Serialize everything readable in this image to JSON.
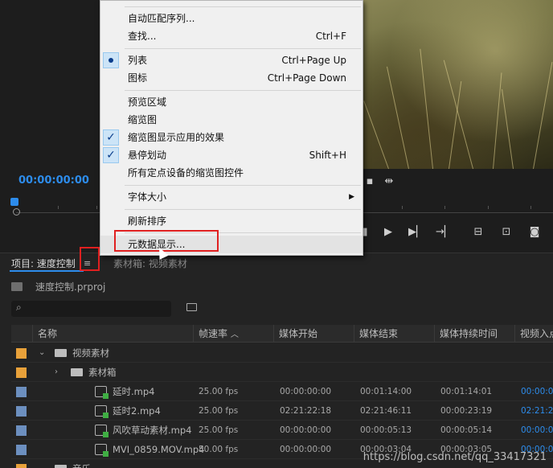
{
  "monitor": {
    "timecode": "00:00:00:00",
    "icons": [
      "marker-icon",
      "play-icon",
      "step-forward-icon",
      "go-to-out-icon",
      "insert-icon",
      "overwrite-icon",
      "camera-icon"
    ]
  },
  "context_menu": {
    "items": [
      {
        "label": "自动匹配序列...",
        "shortcut": ""
      },
      {
        "label": "查找...",
        "shortcut": "Ctrl+F"
      },
      {
        "label": "列表",
        "shortcut": "Ctrl+Page Up",
        "radio": true
      },
      {
        "label": "图标",
        "shortcut": "Ctrl+Page Down"
      },
      {
        "label": "预览区域",
        "shortcut": ""
      },
      {
        "label": "缩览图",
        "shortcut": ""
      },
      {
        "label": "缩览图显示应用的效果",
        "shortcut": "",
        "checked": true
      },
      {
        "label": "悬停划动",
        "shortcut": "Shift+H",
        "checked": true
      },
      {
        "label": "所有定点设备的缩览图控件",
        "shortcut": ""
      },
      {
        "label": "字体大小",
        "shortcut": "",
        "submenu": true
      },
      {
        "label": "刷新排序",
        "shortcut": ""
      },
      {
        "label": "元数据显示...",
        "shortcut": ""
      }
    ]
  },
  "project_panel": {
    "tab_project": "项目: 速度控制",
    "tab_bin": "素材箱: 视频素材",
    "project_file": "速度控制.prproj",
    "search_placeholder": "",
    "columns": [
      "名称",
      "帧速率",
      "媒体开始",
      "媒体结束",
      "媒体持续时间",
      "视频入点"
    ],
    "rows": [
      {
        "type": "folder",
        "name": "视频素材",
        "color": "#e8a13a",
        "expanded": true,
        "indent": 0,
        "fps": "",
        "start": "",
        "end": "",
        "duration": "",
        "in": ""
      },
      {
        "type": "folder",
        "name": "素材箱",
        "color": "#e8a13a",
        "expanded": false,
        "indent": 1,
        "fps": "",
        "start": "",
        "end": "",
        "duration": "",
        "in": ""
      },
      {
        "type": "clip",
        "name": "延时.mp4",
        "color": "#6c8fbf",
        "indent": 2,
        "fps": "25.00 fps",
        "start": "00:00:00:00",
        "end": "00:01:14:00",
        "duration": "00:01:14:01",
        "in": "00:00:00"
      },
      {
        "type": "clip",
        "name": "延时2.mp4",
        "color": "#6c8fbf",
        "indent": 2,
        "fps": "25.00 fps",
        "start": "02:21:22:18",
        "end": "02:21:46:11",
        "duration": "00:00:23:19",
        "in": "02:21:22"
      },
      {
        "type": "clip",
        "name": "风吹草动素材.mp4",
        "color": "#6c8fbf",
        "indent": 2,
        "fps": "25.00 fps",
        "start": "00:00:00:00",
        "end": "00:00:05:13",
        "duration": "00:00:05:14",
        "in": "00:00:00"
      },
      {
        "type": "clip",
        "name": "MVI_0859.MOV.mp4",
        "color": "#6c8fbf",
        "indent": 2,
        "fps": "50.00 fps",
        "start": "00:00:00:00",
        "end": "00:00:03:04",
        "duration": "00:00:03:05",
        "in": "00:00:00"
      },
      {
        "type": "folder",
        "name": "音乐",
        "color": "#e8a13a",
        "expanded": true,
        "indent": 0,
        "fps": "",
        "start": "",
        "end": "",
        "duration": "",
        "in": ""
      }
    ]
  },
  "watermark": "https://blog.csdn.net/qq_33417321"
}
